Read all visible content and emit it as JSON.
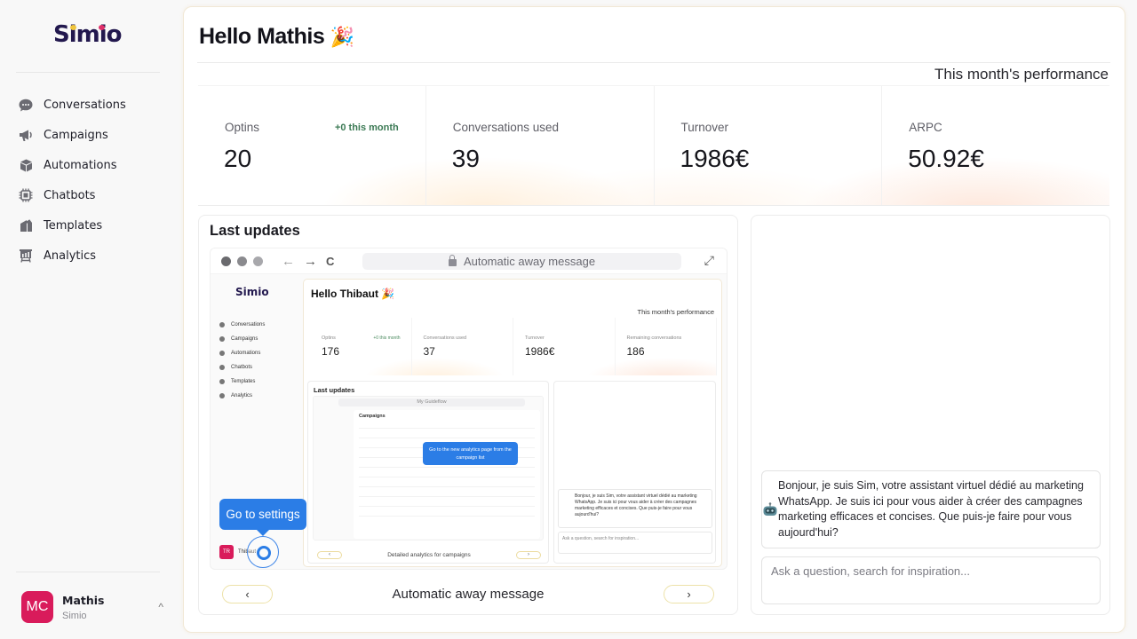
{
  "app": {
    "logo": "Simio"
  },
  "sidebar": {
    "items": [
      {
        "label": "Conversations",
        "icon": "chat-bubble-icon"
      },
      {
        "label": "Campaigns",
        "icon": "megaphone-icon"
      },
      {
        "label": "Automations",
        "icon": "cube-icon"
      },
      {
        "label": "Chatbots",
        "icon": "chip-icon"
      },
      {
        "label": "Templates",
        "icon": "templates-icon"
      },
      {
        "label": "Analytics",
        "icon": "analytics-board-icon"
      }
    ],
    "user": {
      "initials": "MC",
      "name": "Mathis",
      "org": "Simio",
      "chevron": "^"
    }
  },
  "header": {
    "greeting": "Hello Mathis",
    "emoji": "🎉",
    "performance_title": "This month's performance"
  },
  "stats": [
    {
      "label": "Optins",
      "value": "20",
      "delta": "+0 this month"
    },
    {
      "label": "Conversations used",
      "value": "39"
    },
    {
      "label": "Turnover",
      "value": "1986€"
    },
    {
      "label": "ARPC",
      "value": "50.92€"
    }
  ],
  "updates": {
    "title": "Last updates",
    "browser": {
      "url_text": "Automatic away message",
      "back": "←",
      "forward": "→",
      "reload": "C",
      "expand": "⤢"
    },
    "preview": {
      "logo": "Simio",
      "nav": [
        "Conversations",
        "Campaigns",
        "Automations",
        "Chatbots",
        "Templates",
        "Analytics"
      ],
      "greeting": "Hello Thibaut 🎉",
      "performance_title": "This month's performance",
      "stats": [
        {
          "label": "Optins",
          "value": "176",
          "delta": "+0 this month"
        },
        {
          "label": "Conversations used",
          "value": "37"
        },
        {
          "label": "Turnover",
          "value": "1986€"
        },
        {
          "label": "Remaining conversations",
          "value": "186"
        }
      ],
      "inner_updates_title": "Last updates",
      "inner_url": "My Guideflow",
      "inner_page_title": "Campaigns",
      "inner_tooltip": "Go to the new analytics page from the campaign list",
      "inner_slide_title": "Detailed analytics for campaigns",
      "inner_chat_text": "Bonjour, je suis Sim, votre assistant virtuel dédié au marketing WhatsApp. Je suis ici pour vous aider à créer des campagnes marketing efficaces et concises. Que puis-je faire pour vous aujourd'hui?",
      "inner_chat_placeholder": "Ask a question, search for inspiration...",
      "user_initials": "TR",
      "user_name": "Thibaut"
    },
    "tooltip": "Go to settings",
    "slide_title": "Automatic away message",
    "prev": "‹",
    "next": "›"
  },
  "chat": {
    "bot_message": "Bonjour, je suis Sim, votre assistant virtuel dédié au marketing WhatsApp. Je suis ici pour vous aider à créer des campagnes marketing efficaces et concises. Que puis-je faire pour vous aujourd'hui?",
    "input_placeholder": "Ask a question, search for inspiration..."
  },
  "colors": {
    "brand_dark": "#22184e",
    "avatar": "#d91b5b",
    "tooltip_blue": "#2b7de6",
    "delta_green": "#3c7a55",
    "pill_border": "#ede2a9"
  }
}
